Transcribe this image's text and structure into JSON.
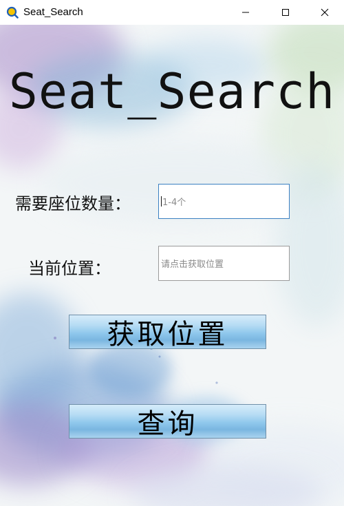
{
  "window": {
    "title": "Seat_Search",
    "icon": "magnifier-app-icon"
  },
  "app_title": "Seat_Search",
  "form": {
    "count_label": "需要座位数量：",
    "count_placeholder": "1-4个",
    "location_label": "当前位置：",
    "location_placeholder": "请点击获取位置"
  },
  "buttons": {
    "get_location": "获取位置",
    "query": "查询"
  },
  "colors": {
    "button_top": "#d6ecfa",
    "button_mid": "#8ec7ec",
    "input_focus_border": "#3a7fc1"
  }
}
